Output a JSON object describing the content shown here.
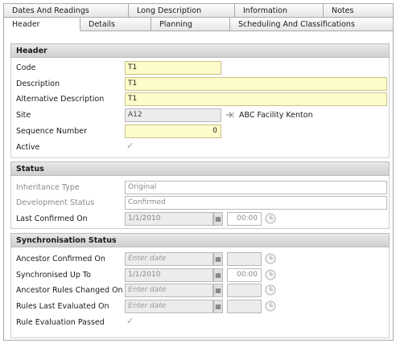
{
  "tabs_row1": [
    "Dates And Readings",
    "Long Description",
    "Information",
    "Notes"
  ],
  "tabs_row2": [
    "Header",
    "Details",
    "Planning",
    "Scheduling And Classifications"
  ],
  "header_section": {
    "title": "Header",
    "code_label": "Code",
    "code_value": "T1",
    "description_label": "Description",
    "description_value": "T1",
    "alt_description_label": "Alternative Description",
    "alt_description_value": "T1",
    "site_label": "Site",
    "site_value": "A12",
    "site_name": "ABC Facility Kenton",
    "sequence_label": "Sequence Number",
    "sequence_value": "0",
    "active_label": "Active",
    "active_checked": true
  },
  "status_section": {
    "title": "Status",
    "inheritance_label": "Inheritance Type",
    "inheritance_value": "Original",
    "development_label": "Development Status",
    "development_value": "Confirmed",
    "last_confirmed_label": "Last Confirmed On",
    "last_confirmed_date": "1/1/2010",
    "last_confirmed_time": "00:00"
  },
  "sync_section": {
    "title": "Synchronisation Status",
    "ancestor_confirmed_label": "Ancestor Confirmed On",
    "ancestor_confirmed_placeholder": "Enter date",
    "synchronised_label": "Synchronised Up To",
    "synchronised_date": "1/1/2010",
    "synchronised_time": "00:00",
    "ancestor_rules_label": "Ancestor Rules Changed On",
    "ancestor_rules_placeholder": "Enter date",
    "rules_evaluated_label": "Rules Last Evaluated On",
    "rules_evaluated_placeholder": "Enter date",
    "rule_passed_label": "Rule Evaluation Passed",
    "rule_passed_checked": true
  },
  "icons": {
    "calendar": "calendar-icon",
    "clock": "clock-icon",
    "check": "checkmark-icon",
    "lookup": "lookup-arrow-icon"
  },
  "colors": {
    "required_field": "#fdfbc9",
    "readonly_field": "#ececec",
    "section_header": "#d6d6d6"
  }
}
